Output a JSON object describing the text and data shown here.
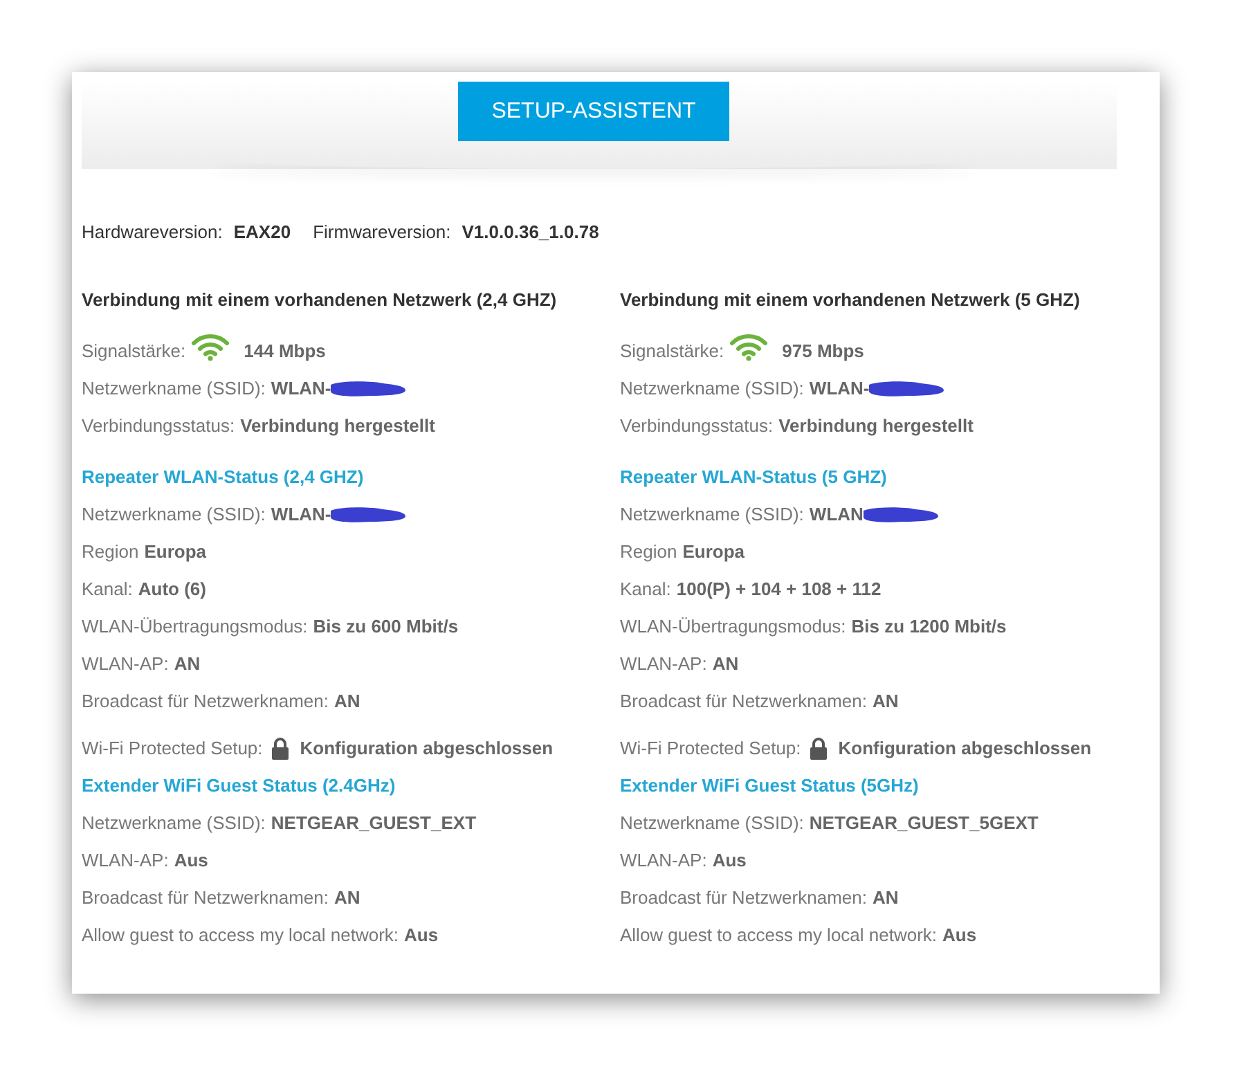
{
  "setup_button": "SETUP-ASSISTENT",
  "versions": [
    {
      "label": "Hardwareversion:",
      "value": "EAX20"
    },
    {
      "label": "Firmwareversion:",
      "value": "V1.0.0.36_1.0.78"
    }
  ],
  "columns": [
    {
      "sections": [
        {
          "kind": "network",
          "title": "Verbindung mit einem vorhandenen Netzwerk (2,4 GHZ)",
          "rows": [
            {
              "kind": "signal",
              "label": "Signalstärke:",
              "value": "144 Mbps"
            },
            {
              "kind": "redacted",
              "label": "Netzwerkname (SSID):",
              "value": "WLAN-"
            },
            {
              "kind": "text",
              "label": "Verbindungsstatus:",
              "value": "Verbindung hergestellt"
            }
          ]
        },
        {
          "kind": "repeater",
          "title": "Repeater WLAN-Status (2,4 GHZ)",
          "rows": [
            {
              "kind": "redacted",
              "label": "Netzwerkname (SSID):",
              "value": "WLAN-"
            },
            {
              "kind": "text",
              "label": "Region",
              "value": "Europa"
            },
            {
              "kind": "text",
              "label": "Kanal:",
              "value": "Auto (6)"
            },
            {
              "kind": "text",
              "label": "WLAN-Übertragungsmodus:",
              "value": "Bis zu 600 Mbit/s"
            },
            {
              "kind": "text",
              "label": "WLAN-AP:",
              "value": "AN"
            },
            {
              "kind": "text",
              "label": "Broadcast für Netzwerknamen:",
              "value": "AN"
            },
            {
              "kind": "lock",
              "label": "Wi-Fi Protected Setup:",
              "value": "Konfiguration abgeschlossen"
            }
          ]
        },
        {
          "kind": "guest",
          "title": "Extender WiFi Guest Status (2.4GHz)",
          "rows": [
            {
              "kind": "text",
              "label": "Netzwerkname (SSID):",
              "value": "NETGEAR_GUEST_EXT"
            },
            {
              "kind": "text",
              "label": "WLAN-AP:",
              "value": "Aus"
            },
            {
              "kind": "text",
              "label": "Broadcast für Netzwerknamen:",
              "value": "AN"
            },
            {
              "kind": "text",
              "label": "Allow guest to access my local network:",
              "value": "Aus"
            }
          ]
        }
      ]
    },
    {
      "sections": [
        {
          "kind": "network",
          "title": "Verbindung mit einem vorhandenen Netzwerk (5 GHZ)",
          "rows": [
            {
              "kind": "signal",
              "label": "Signalstärke:",
              "value": "975 Mbps"
            },
            {
              "kind": "redacted",
              "label": "Netzwerkname (SSID):",
              "value": "WLAN-"
            },
            {
              "kind": "text",
              "label": "Verbindungsstatus:",
              "value": "Verbindung hergestellt"
            }
          ]
        },
        {
          "kind": "repeater",
          "title": "Repeater WLAN-Status (5 GHZ)",
          "rows": [
            {
              "kind": "redacted",
              "label": "Netzwerkname (SSID):",
              "value": "WLAN"
            },
            {
              "kind": "text",
              "label": "Region",
              "value": "Europa"
            },
            {
              "kind": "text",
              "label": "Kanal:",
              "value": "100(P) + 104 + 108 + 112"
            },
            {
              "kind": "text",
              "label": "WLAN-Übertragungsmodus:",
              "value": "Bis zu 1200 Mbit/s"
            },
            {
              "kind": "text",
              "label": "WLAN-AP:",
              "value": "AN"
            },
            {
              "kind": "text",
              "label": "Broadcast für Netzwerknamen:",
              "value": "AN"
            },
            {
              "kind": "lock",
              "label": "Wi-Fi Protected Setup:",
              "value": "Konfiguration abgeschlossen"
            }
          ]
        },
        {
          "kind": "guest",
          "title": "Extender WiFi Guest Status (5GHz)",
          "rows": [
            {
              "kind": "text",
              "label": "Netzwerkname (SSID):",
              "value": "NETGEAR_GUEST_5GEXT"
            },
            {
              "kind": "text",
              "label": "WLAN-AP:",
              "value": "Aus"
            },
            {
              "kind": "text",
              "label": "Broadcast für Netzwerknamen:",
              "value": "AN"
            },
            {
              "kind": "text",
              "label": "Allow guest to access my local network:",
              "value": "Aus"
            }
          ]
        }
      ]
    }
  ]
}
